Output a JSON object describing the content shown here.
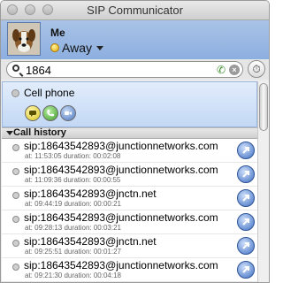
{
  "window": {
    "title": "SIP Communicator"
  },
  "account": {
    "name": "Me",
    "status": "Away"
  },
  "search": {
    "value": "1864"
  },
  "contact": {
    "name": "Cell phone"
  },
  "history": {
    "label": "Call history",
    "rows": [
      {
        "number": "sip:18643542893@junctionnetworks.com",
        "meta": "at: 11:53:05 duration: 00:02:08"
      },
      {
        "number": "sip:18643542893@junctionnetworks.com",
        "meta": "at: 11:09:36 duration: 00:00:55"
      },
      {
        "number": "sip:18643542893@jnctn.net",
        "meta": "at: 09:44:19 duration: 00:00:21"
      },
      {
        "number": "sip:18643542893@junctionnetworks.com",
        "meta": "at: 09:28:13 duration: 00:03:21"
      },
      {
        "number": "sip:18643542893@jnctn.net",
        "meta": "at: 09:25:51 duration: 00:01:27"
      },
      {
        "number": "sip:18643542893@junctionnetworks.com",
        "meta": "at: 09:21:30 duration: 00:04:18"
      }
    ]
  }
}
